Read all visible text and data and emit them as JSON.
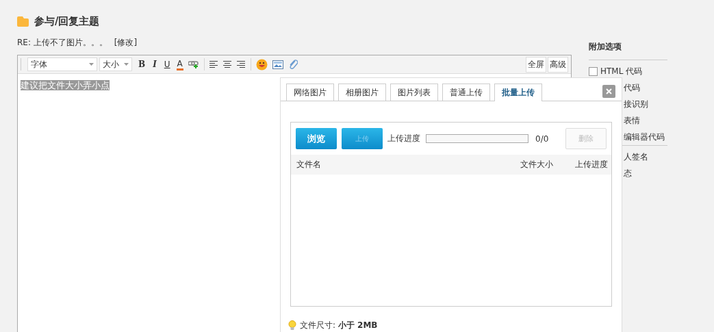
{
  "page_title": "参与/回复主题",
  "subject": "RE: 上传不了图片。。。",
  "edit_link": "[修改]",
  "editor": {
    "font_select": "字体",
    "size_select": "大小",
    "tools": [
      {
        "kind": "bold",
        "label": "B"
      },
      {
        "kind": "italic",
        "label": "I"
      },
      {
        "kind": "underline",
        "label": "U"
      },
      {
        "kind": "color",
        "label": "A"
      },
      {
        "kind": "link"
      },
      {
        "kind": "sep"
      },
      {
        "kind": "align-left"
      },
      {
        "kind": "align-center"
      },
      {
        "kind": "align-right"
      },
      {
        "kind": "sep"
      },
      {
        "kind": "smiley"
      },
      {
        "kind": "image"
      },
      {
        "kind": "attach"
      }
    ],
    "right_buttons": [
      "全屏",
      "高级"
    ],
    "content": {
      "text": "建议把文件大小弄小点",
      "selected": true
    }
  },
  "sidebar": {
    "title": "附加选项",
    "groups": [
      [
        {
          "kind": "checkbox",
          "label": "HTML 代码",
          "checked": false
        },
        {
          "kind": "clipped",
          "label": "代码"
        },
        {
          "kind": "clipped",
          "label": "接识别"
        },
        {
          "kind": "clipped",
          "label": "表情"
        },
        {
          "kind": "clipped",
          "label": "编辑器代码"
        }
      ],
      [
        {
          "kind": "clipped",
          "label": "人签名"
        },
        {
          "kind": "clipped",
          "label": "态"
        }
      ]
    ]
  },
  "dialog": {
    "tabs": [
      {
        "label": "网络图片",
        "selected": false
      },
      {
        "label": "相册图片",
        "selected": false
      },
      {
        "label": "图片列表",
        "selected": false
      },
      {
        "label": "普通上传",
        "selected": false
      },
      {
        "label": "批量上传",
        "selected": true
      }
    ],
    "browse_button": {
      "label": "浏览",
      "disabled": false
    },
    "upload_button": {
      "label": "上传",
      "disabled": true
    },
    "progress_label": "上传进度",
    "progress": {
      "level": 0
    },
    "progress_count": "0/0",
    "delete_button": {
      "label": "删除",
      "disabled": true
    },
    "columns": [
      "文件名",
      "文件大小",
      "上传进度"
    ],
    "note": "文件尺寸: **小于 2MB**"
  }
}
